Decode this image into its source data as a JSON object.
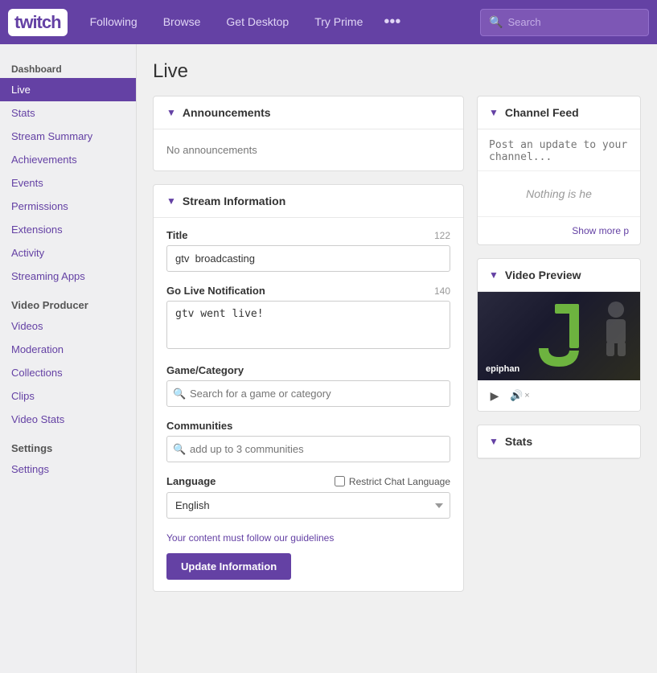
{
  "topnav": {
    "logo": "twitch",
    "links": [
      "Following",
      "Browse",
      "Get Desktop",
      "Try Prime"
    ],
    "dots_label": "•••",
    "search_placeholder": "Search"
  },
  "sidebar": {
    "dashboard_label": "Dashboard",
    "items": [
      {
        "id": "live",
        "label": "Live",
        "active": true
      },
      {
        "id": "stats",
        "label": "Stats",
        "active": false
      },
      {
        "id": "stream-summary",
        "label": "Stream Summary",
        "active": false
      },
      {
        "id": "achievements",
        "label": "Achievements",
        "active": false
      },
      {
        "id": "events",
        "label": "Events",
        "active": false
      },
      {
        "id": "permissions",
        "label": "Permissions",
        "active": false
      },
      {
        "id": "extensions",
        "label": "Extensions",
        "active": false
      },
      {
        "id": "activity",
        "label": "Activity",
        "active": false
      },
      {
        "id": "streaming-apps",
        "label": "Streaming Apps",
        "active": false
      }
    ],
    "video_producer_label": "Video Producer",
    "video_producer_items": [
      {
        "id": "videos",
        "label": "Videos"
      },
      {
        "id": "moderation",
        "label": "Moderation"
      },
      {
        "id": "collections",
        "label": "Collections"
      },
      {
        "id": "clips",
        "label": "Clips"
      },
      {
        "id": "video-stats",
        "label": "Video Stats"
      }
    ],
    "settings_label": "Settings",
    "settings_items": [
      {
        "id": "settings",
        "label": "Settings"
      }
    ]
  },
  "main": {
    "page_title": "Live",
    "announcements_panel": {
      "header": "Announcements",
      "no_announcements": "No announcements"
    },
    "stream_info_panel": {
      "header": "Stream Information",
      "title_label": "Title",
      "title_counter": "122",
      "title_value": "gtv  broadcasting",
      "go_live_label": "Go Live Notification",
      "go_live_counter": "140",
      "go_live_value": "gtv went live!",
      "game_label": "Game/Category",
      "game_placeholder": "Search for a game or category",
      "communities_label": "Communities",
      "communities_placeholder": "add up to 3 communities",
      "language_label": "Language",
      "restrict_label": "Restrict Chat Language",
      "language_value": "English",
      "guidelines_text": "Your content must follow our guidelines",
      "update_btn": "Update Information"
    }
  },
  "right": {
    "channel_feed": {
      "header": "Channel Feed",
      "input_placeholder": "Post an update to your channel...",
      "nothing_text": "Nothing is he",
      "show_more": "Show more p"
    },
    "video_preview": {
      "header": "Video Preview",
      "epiphan_brand": "epiphan",
      "play_icon": "▶",
      "volume_icon": "🔊",
      "mute_x": "×"
    },
    "stats": {
      "header": "Stats"
    }
  }
}
